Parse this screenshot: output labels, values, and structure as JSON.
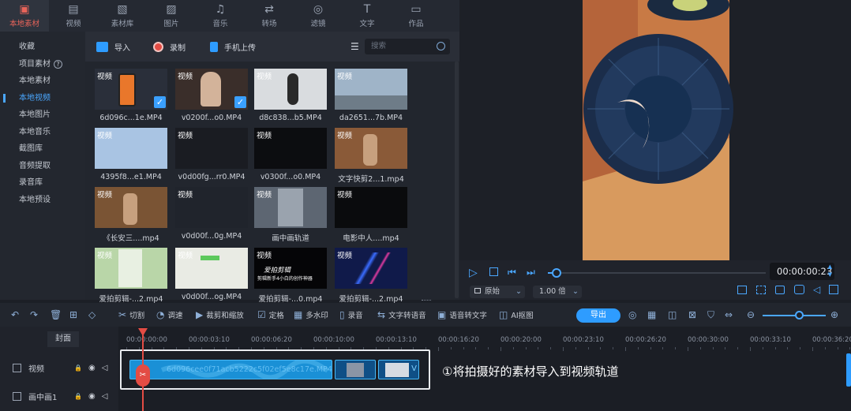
{
  "top_tabs": [
    {
      "label": "本地素材",
      "icon": "local-material-icon",
      "glyph": "▣",
      "active": true
    },
    {
      "label": "视频",
      "icon": "film-icon",
      "glyph": "▤"
    },
    {
      "label": "素材库",
      "icon": "library-icon",
      "glyph": "▧"
    },
    {
      "label": "图片",
      "icon": "image-icon",
      "glyph": "▨"
    },
    {
      "label": "音乐",
      "icon": "music-icon",
      "glyph": "♫"
    },
    {
      "label": "转场",
      "icon": "transition-icon",
      "glyph": "⇄"
    },
    {
      "label": "滤镜",
      "icon": "filter-icon",
      "glyph": "◎"
    },
    {
      "label": "文字",
      "icon": "text-icon",
      "glyph": "T"
    },
    {
      "label": "作品",
      "icon": "folder-icon",
      "glyph": "▭"
    }
  ],
  "sidebar": {
    "items": [
      {
        "label": "收藏"
      },
      {
        "label": "项目素材",
        "help": "?"
      },
      {
        "label": "本地素材"
      },
      {
        "label": "本地视频",
        "active": true
      },
      {
        "label": "本地图片"
      },
      {
        "label": "本地音乐"
      },
      {
        "label": "截图库"
      },
      {
        "label": "音频提取"
      },
      {
        "label": "录音库"
      },
      {
        "label": "本地预设"
      }
    ]
  },
  "media_header": {
    "import_label": "导入",
    "record_label": "录制",
    "upload_label": "手机上传",
    "search_placeholder": "搜索",
    "sort_glyph": "☰"
  },
  "media": [
    {
      "tag": "视频",
      "name": "6d096c...1e.MP4",
      "checked": true,
      "bg": "#2a2f3a"
    },
    {
      "tag": "视频",
      "name": "v0200f...o0.MP4",
      "checked": true,
      "bg": "#3a2e2a"
    },
    {
      "tag": "视频",
      "name": "d8c838...b5.MP4",
      "checked": false,
      "bg": "#d9dcdf"
    },
    {
      "tag": "视频",
      "name": "da2651...7b.MP4",
      "checked": false,
      "bg": "#9fb4c8"
    },
    {
      "tag": "视频",
      "name": "4395f8...e1.MP4",
      "checked": false,
      "bg": "#a9c4e3"
    },
    {
      "tag": "视频",
      "name": "v0d00fg...rr0.MP4",
      "checked": false,
      "bg": "#1a1c22"
    },
    {
      "tag": "视频",
      "name": "v0300f...o0.MP4",
      "checked": false,
      "bg": "#0c0d10"
    },
    {
      "tag": "视频",
      "name": "文字快剪2...1.mp4",
      "checked": false,
      "bg": "#8a5a38"
    },
    {
      "tag": "视频",
      "name": "《长安三....mp4",
      "checked": false,
      "bg": "#7a5434"
    },
    {
      "tag": "视频",
      "name": "v0d00f...0g.MP4",
      "checked": false,
      "bg": "#20242c"
    },
    {
      "tag": "视频",
      "name": "画中画轨道",
      "checked": false,
      "bg": "#5d6672"
    },
    {
      "tag": "视频",
      "name": "电影中人....mp4",
      "checked": false,
      "bg": "#0a0b0d"
    },
    {
      "tag": "视频",
      "name": "爱拍剪辑-...2.mp4",
      "checked": false,
      "bg": "#b9d6a8"
    },
    {
      "tag": "视频",
      "name": "v0d00f...og.MP4",
      "checked": false,
      "bg": "#e9ebe4"
    },
    {
      "tag": "视频",
      "name": "爱拍剪辑-...0.mp4",
      "checked": false,
      "bg": "#050507"
    },
    {
      "tag": "视频",
      "name": "爱拍剪辑-...2.mp4",
      "checked": false,
      "bg": "#101a4a"
    }
  ],
  "thumb_texts": {
    "t15": "爱拍剪辑",
    "t15b": "剪辑新手4小白的创作神器"
  },
  "player": {
    "time": "00:00:00:23",
    "ratio_label": "原始",
    "speed_label": "1.00 倍",
    "progress": 0.04
  },
  "toolbar": {
    "cut": "切割",
    "speed": "调速",
    "crop": "裁剪和缩放",
    "keyframe": "定格",
    "mosaic": "多水印",
    "record": "录音",
    "tts": "文字转语音",
    "stt": "语音转文字",
    "ai": "AI抠图",
    "export": "导出"
  },
  "zoom_level": 0.58,
  "timeline": {
    "cover": "封面",
    "ticks": [
      "00:00:00:00",
      "00:00:03:10",
      "00:00:06:20",
      "00:00:10:00",
      "00:00:13:10",
      "00:00:16:20",
      "00:00:20:00",
      "00:00:23:10",
      "00:00:26:20",
      "00:00:30:00",
      "00:00:33:10",
      "00:00:36:20"
    ],
    "tracks": [
      {
        "label": "视频"
      },
      {
        "label": "画中画1"
      }
    ],
    "clip_label": "6d096cee0f71acb5222c5f02ef5e8c17e.MP4",
    "annotation": "①将拍摄好的素材导入到视频轨道"
  },
  "colors": {
    "accent": "#2e9cff",
    "active_tab": "#e8645a",
    "playhead": "#e34c44"
  }
}
